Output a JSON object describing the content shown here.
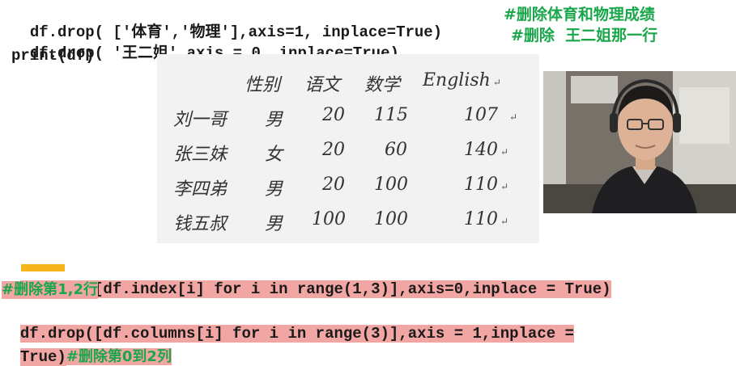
{
  "code_top": {
    "line1": "df.drop( ['体育','物理'],axis=1, inplace=True)",
    "line1_comment": "#删除体育和物理成绩",
    "line2": "df.drop( '王二姐',axis = 0, inplace=True)",
    "line2_comment": "#删除  王二姐那一行",
    "line3": "print(df)"
  },
  "table": {
    "headers": [
      "性别",
      "语文",
      "数学",
      "English"
    ],
    "rows": [
      {
        "index": "刘一哥",
        "cells": [
          "男",
          "20",
          "115",
          "107"
        ]
      },
      {
        "index": "张三妹",
        "cells": [
          "女",
          "20",
          "60",
          "140"
        ]
      },
      {
        "index": "李四弟",
        "cells": [
          "男",
          "20",
          "100",
          "110"
        ]
      },
      {
        "index": "钱五叔",
        "cells": [
          "男",
          "100",
          "100",
          "110"
        ]
      }
    ],
    "return_mark": "↵"
  },
  "code_bottom": {
    "line1": "df.drop([df.index[i] for i in range(1,3)],axis=0,inplace = True)",
    "line2_comment": "#删除第1,2行",
    "line3": "df.drop([df.columns[i] for i in range(3)],axis = 1,inplace =",
    "line4": "True)",
    "line4_comment": "#删除第0到2列"
  },
  "colors": {
    "comment": "#1aa64a",
    "highlight": "#f2a6a3",
    "cursor": "#f7b51c",
    "panel": "#f2f2f2"
  }
}
